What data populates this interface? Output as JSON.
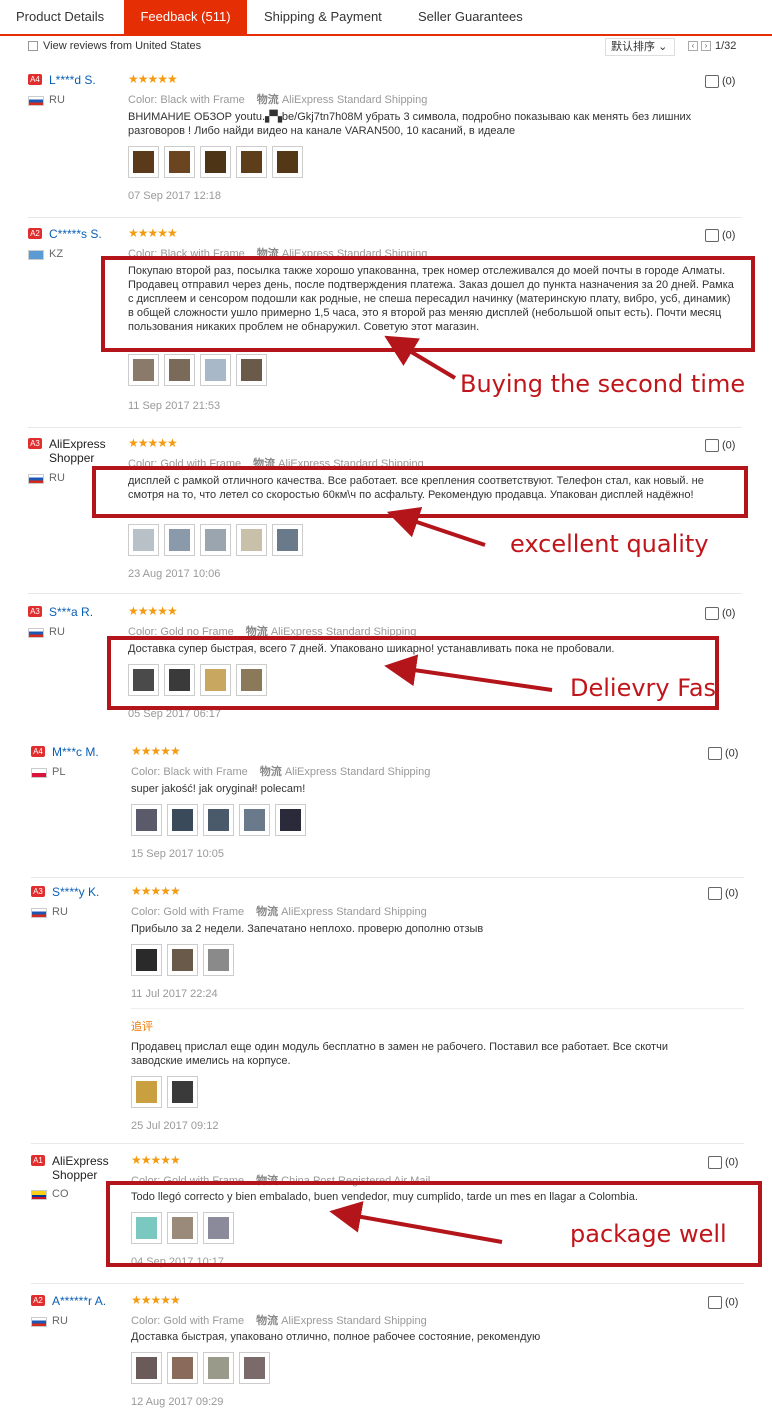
{
  "tabs": [
    {
      "label": "Product Details"
    },
    {
      "label": "Feedback (511)"
    },
    {
      "label": "Shipping & Payment"
    },
    {
      "label": "Seller Guarantees"
    }
  ],
  "filter": {
    "label": "View reviews from United States",
    "sort_label": "默认排序",
    "page": "1/32"
  },
  "labels": {
    "color": "Color:",
    "ship_icon": "物流",
    "append": "追评"
  },
  "reviews": [
    {
      "level": "A4",
      "name": "L****d S.",
      "country": "RU",
      "color": "Black with Frame",
      "shipping": "AliExpress Standard Shipping",
      "text": "ВНИМАНИЕ ОБЗОР youtu.▞▚be/Gkj7tn7h08M убрать 3 символа, подробно показываю как менять без лишних разговоров ! Либо найди видео на канале VARAN500, 10 касаний, в идеале",
      "date": "07 Sep 2017 12:18",
      "likes": "(0)"
    },
    {
      "level": "A2",
      "name": "C*****s S.",
      "country": "KZ",
      "color": "Black with Frame",
      "shipping": "AliExpress Standard Shipping",
      "text": "Покупаю второй раз, посылка также хорошо упакованна, трек номер отслеживался до моей почты в городе Алматы. Продавец отправил через день, после подтверждения платежа. Заказ дошел до пункта назначения за 20 дней. Рамка с дисплеем и сенсором подошли как родные, не спеша пересадил начинку (материнскую плату, вибро, усб, динамик) в общей сложности ушло примерно 1,5 часа, это я второй раз меняю дисплей (небольшой опыт есть). Почти месяц пользования никаких проблем не обнаружил. Советую этот магазин.",
      "date": "11 Sep 2017 21:53",
      "likes": "(0)"
    },
    {
      "level": "A3",
      "name": "AliExpress Shopper",
      "country": "RU",
      "color": "Gold with Frame",
      "shipping": "AliExpress Standard Shipping",
      "text": "дисплей с рамкой отличного качества. Все работает. все крепления соответствуют. Телефон стал, как новый. не смотря на то, что летел со скоростью 60км\\ч по асфальту. Рекомендую продавца. Упакован дисплей надёжно!",
      "date": "23 Aug 2017 10:06",
      "likes": "(0)"
    },
    {
      "level": "A3",
      "name": "S***a R.",
      "country": "RU",
      "color": "Gold no Frame",
      "shipping": "AliExpress Standard Shipping",
      "text": "Доставка супер быстрая, всего 7 дней. Упаковано шикарно! устанавливать пока не пробовали.",
      "date": "05 Sep 2017 06:17",
      "likes": "(0)"
    },
    {
      "level": "A4",
      "name": "M***c M.",
      "country": "PL",
      "color": "Black with Frame",
      "shipping": "AliExpress Standard Shipping",
      "text": "super jakość! jak oryginał! polecam!",
      "date": "15 Sep 2017 10:05",
      "likes": "(0)"
    },
    {
      "level": "A3",
      "name": "S****y K.",
      "country": "RU",
      "color": "Gold with Frame",
      "shipping": "AliExpress Standard Shipping",
      "text": "Прибыло за 2 недели. Запечатано неплохо. проверю дополню отзыв",
      "date": "11 Jul 2017 22:24",
      "likes": "(0)",
      "followup_text": "Продавец прислал еще один модуль бесплатно в замен не рабочего. Поставил все работает. Все скотчи заводские имелись на корпусе.",
      "followup_date": "25 Jul 2017 09:12"
    },
    {
      "level": "A1",
      "name": "AliExpress Shopper",
      "country": "CO",
      "color": "Gold with Frame",
      "shipping": "China Post Registered Air Mail",
      "text": "Todo llegó correcto y bien embalado, buen vendedor, muy cumplido, tarde un mes en llagar a Colombia.",
      "date": "04 Sep 2017 10:17",
      "likes": "(0)"
    },
    {
      "level": "A2",
      "name": "A******r A.",
      "country": "RU",
      "color": "Gold with Frame",
      "shipping": "AliExpress Standard Shipping",
      "text": "Доставка быстрая, упаковано отлично, полное рабочее состояние, рекомендую",
      "date": "12 Aug 2017 09:29",
      "likes": "(0)"
    }
  ],
  "annotations": [
    {
      "label": "Buying the second time"
    },
    {
      "label": "excellent quality"
    },
    {
      "label": "Delievry Fast"
    },
    {
      "label": "package well"
    }
  ],
  "colors": {
    "accent": "#e62e04",
    "link": "#0a5fb4",
    "star": "#f39c12",
    "annotation": "#b3151b"
  }
}
